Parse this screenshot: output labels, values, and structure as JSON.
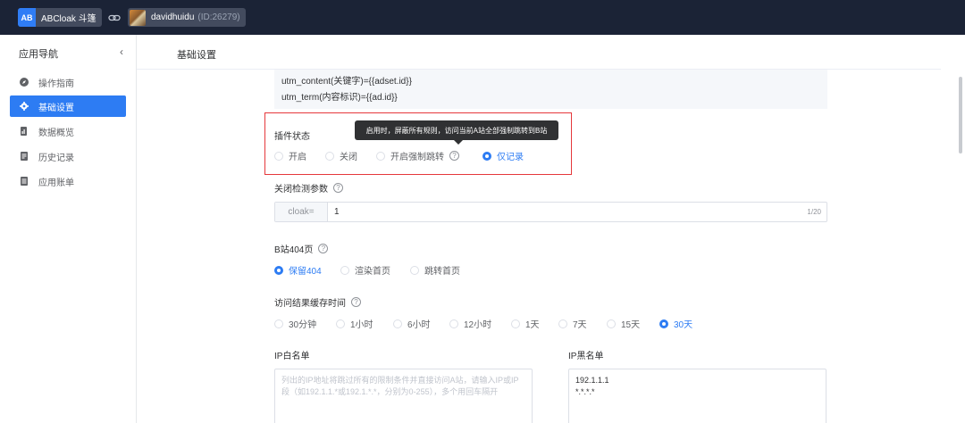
{
  "topbar": {
    "brand_logo": "AB",
    "brand_name": "ABCloak 斗篷",
    "user_name": "davidhuidu",
    "user_id": "(ID:26279)"
  },
  "sidebar": {
    "title": "应用导航",
    "collapse": "‹",
    "items": [
      {
        "label": "操作指南",
        "icon": "compass-icon",
        "active": false
      },
      {
        "label": "基础设置",
        "icon": "gear-icon",
        "active": true
      },
      {
        "label": "数据概览",
        "icon": "chart-doc-icon",
        "active": false
      },
      {
        "label": "历史记录",
        "icon": "document-icon",
        "active": false
      },
      {
        "label": "应用账单",
        "icon": "bill-icon",
        "active": false
      }
    ]
  },
  "main": {
    "title": "基础设置",
    "utm_lines": [
      "utm_content(关键字)={{adset.id}}",
      "utm_term(内容标识)={{ad.id}}"
    ],
    "plugin_status": {
      "label": "插件状态",
      "tooltip": "启用时，屏蔽所有规则，访问当前A站全部强制跳转到B站",
      "options": [
        "开启",
        "关闭",
        "开启强制跳转",
        "仅记录"
      ],
      "selected": "仅记录"
    },
    "close_param": {
      "label": "关闭检测参数",
      "prefix": "cloak=",
      "value": "1",
      "counter": "1/20"
    },
    "b404": {
      "label": "B站404页",
      "options": [
        "保留404",
        "渲染首页",
        "跳转首页"
      ],
      "selected": "保留404"
    },
    "cache_time": {
      "label": "访问结果缓存时间",
      "options": [
        "30分钟",
        "1小时",
        "6小时",
        "12小时",
        "1天",
        "7天",
        "15天",
        "30天"
      ],
      "selected": "30天"
    },
    "ip_whitelist": {
      "label": "IP白名单",
      "placeholder": "列出的IP地址将跳过所有的限制条件并直接访问A站，请输入IP或IP段（如192.1.1.*或192.1.*.*，分别为0-255），多个用回车隔开"
    },
    "ip_blacklist": {
      "label": "IP黑名单",
      "lines": [
        "192.1.1.1",
        "*.*.*.*"
      ]
    }
  },
  "colors": {
    "topbar": "#1b2336",
    "accent": "#2d7cf3",
    "highlight_border": "#e5383b"
  }
}
